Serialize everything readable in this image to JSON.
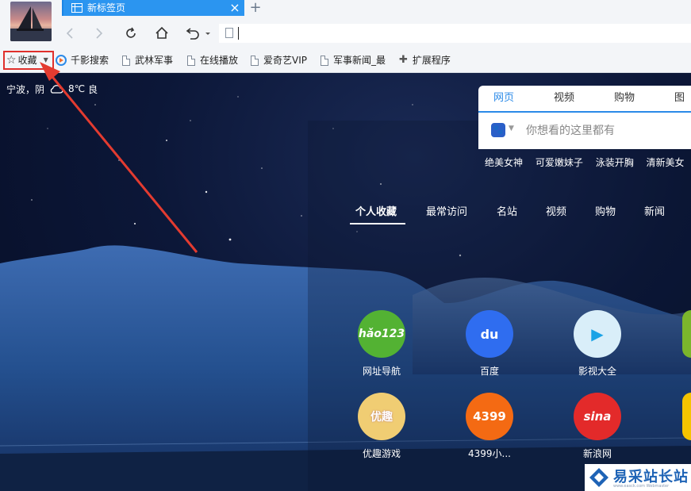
{
  "browser": {
    "tab": {
      "title": "新标签页"
    },
    "colors": {
      "tab_active": "#2b95f0",
      "tabstrip": "#1b85e6",
      "chrome_bg": "#f3f5f8"
    },
    "nav_icons": [
      "back-icon",
      "forward-icon",
      "refresh-icon",
      "home-icon",
      "undo-icon"
    ]
  },
  "bookmarks": {
    "favorites_label": "收藏",
    "items": [
      {
        "label": "千影搜索",
        "icon": "qianying-icon"
      },
      {
        "label": "武林军事",
        "icon": "page-icon"
      },
      {
        "label": "在线播放",
        "icon": "page-icon"
      },
      {
        "label": "爱奇艺VIP",
        "icon": "page-icon"
      },
      {
        "label": "军事新闻_最",
        "icon": "page-icon"
      },
      {
        "label": "扩展程序",
        "icon": "puzzle-icon"
      }
    ]
  },
  "weather": {
    "city": "宁波，阴",
    "temp": "8℃",
    "quality": "良"
  },
  "search": {
    "tabs": [
      "网页",
      "视频",
      "购物",
      "图片"
    ],
    "active_tab": "网页",
    "placeholder": "你想看的这里都有",
    "hotwords": [
      "绝美女神",
      "可爱嫩妹子",
      "泳装开胸",
      "清新美女"
    ]
  },
  "nav_tabs": [
    "个人收藏",
    "最常访问",
    "名站",
    "视频",
    "购物",
    "新闻"
  ],
  "sites": [
    {
      "label": "网址导航",
      "icon_text": "hǎo123",
      "color": "#53b233"
    },
    {
      "label": "百度",
      "icon_text": "du",
      "color": "#2f6df0"
    },
    {
      "label": "影视大全",
      "icon_text": "▶",
      "color": "#d9eef9"
    },
    {
      "label": "优趣游戏",
      "icon_text": "优趣",
      "color": "#f0cd73"
    },
    {
      "label": "4399小...",
      "icon_text": "4399",
      "color": "#f46a13"
    },
    {
      "label": "新浪网",
      "icon_text": "sina",
      "color": "#e32a2a"
    }
  ],
  "watermark": {
    "text": "易采站长站",
    "sub": "www.easck.com Webmaster"
  }
}
